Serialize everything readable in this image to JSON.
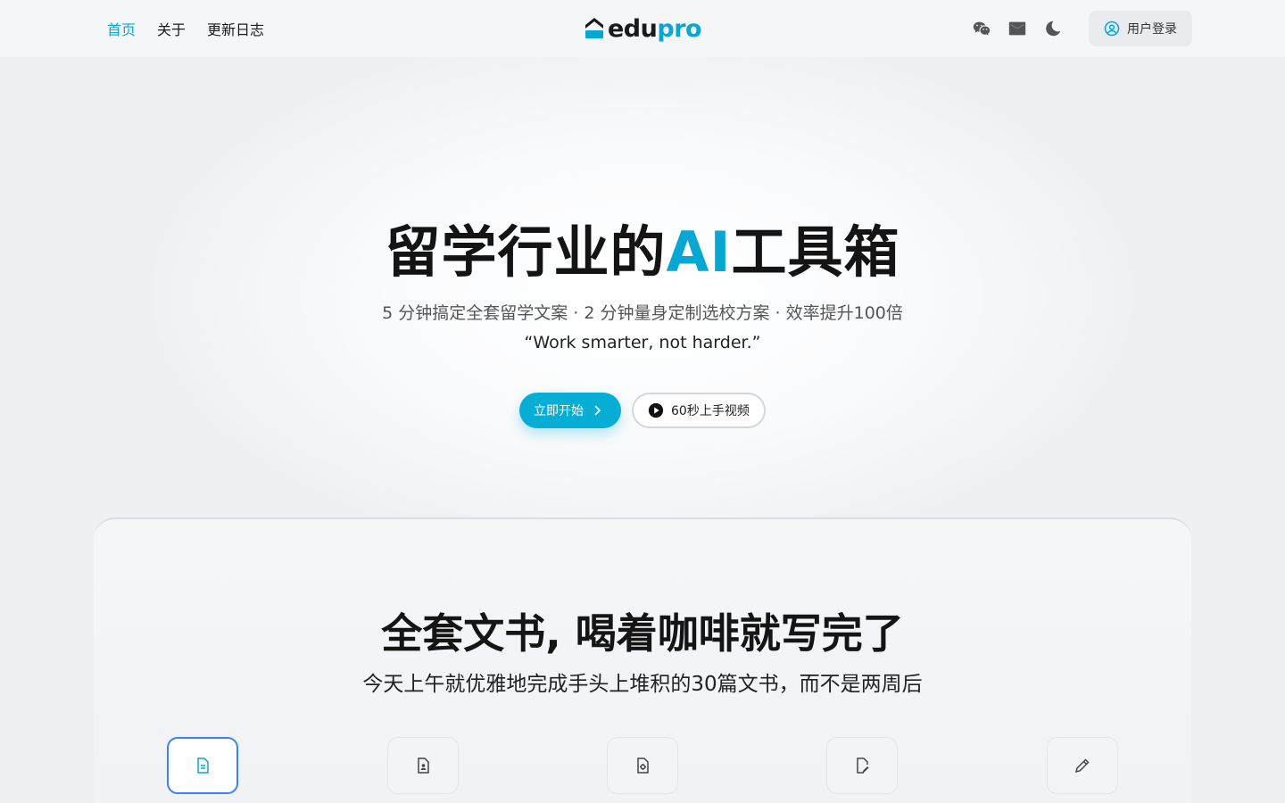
{
  "nav": {
    "links": [
      {
        "label": "首页",
        "active": true
      },
      {
        "label": "关于",
        "active": false
      },
      {
        "label": "更新日志",
        "active": false
      }
    ],
    "logo": {
      "part1": "edu",
      "part2": "pro"
    },
    "icons": [
      "wechat-icon",
      "mail-icon",
      "moon-icon"
    ],
    "login_label": "用户登录"
  },
  "hero": {
    "title_before": "留学行业的",
    "title_accent": "AI",
    "title_after": "工具箱",
    "subtitle": "5 分钟搞定全套留学文案 · 2 分钟量身定制选校方案 · 效率提升100倍",
    "quote": "“Work smarter, not harder.”",
    "primary_button": "立即开始",
    "secondary_button": "60秒上手视频"
  },
  "section": {
    "title": "全套文书, 喝着咖啡就写完了",
    "subtitle": "今天上午就优雅地完成手头上堆积的30篇文书，而不是两周后",
    "tools": [
      {
        "icon": "document-icon",
        "active": true
      },
      {
        "icon": "user-document-icon",
        "active": false
      },
      {
        "icon": "file-settings-icon",
        "active": false
      },
      {
        "icon": "file-edit-icon",
        "active": false
      },
      {
        "icon": "pencil-icon",
        "active": false
      }
    ]
  },
  "colors": {
    "accent": "#06a7d3",
    "active_border": "#3b82f6"
  }
}
